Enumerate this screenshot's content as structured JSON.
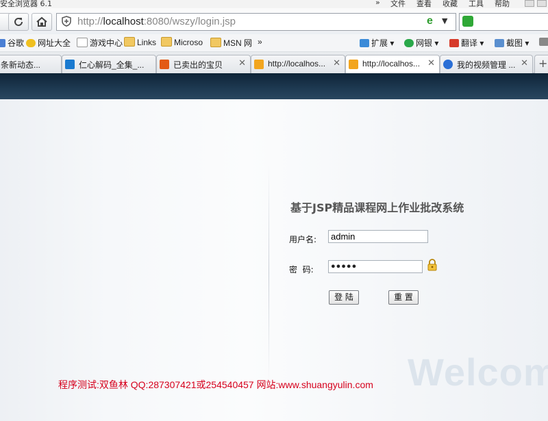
{
  "window": {
    "title": "安全浏览器 6.1",
    "menu": [
      "»",
      "文件",
      "查看",
      "收藏",
      "工具",
      "帮助"
    ]
  },
  "nav": {
    "url_prefix": "http://",
    "url_host": "localhost",
    "url_rest": ":8080/wszy/login.jsp"
  },
  "bookmarks": [
    "谷歌",
    "网址大全",
    "游戏中心",
    "Links",
    "Microso",
    "MSN 网",
    "»",
    "扩展",
    "网银",
    "翻译",
    "截图"
  ],
  "tabs": [
    {
      "label": "条新动态..."
    },
    {
      "label": "仁心解码_全集_..."
    },
    {
      "label": "已卖出的宝贝"
    },
    {
      "label": "http://localhos..."
    },
    {
      "label": "http://localhos..."
    },
    {
      "label": "我的视频管理 ..."
    }
  ],
  "login": {
    "title": "基于JSP精品课程网上作业批改系统",
    "username_label": "用户名:",
    "username_value": "admin",
    "password_label": "密  码:",
    "password_value": "●●●●●",
    "login_button": "登 陆",
    "reset_button": "重 置"
  },
  "watermark": "Welcome",
  "footer": "程序测试:双鱼林 QQ:287307421或254540457 网站:www.shuangyulin.com",
  "colors": {
    "banner": "#1e3a52",
    "footer_text": "#d6001c",
    "ie_icon": "#2e9d2e"
  }
}
